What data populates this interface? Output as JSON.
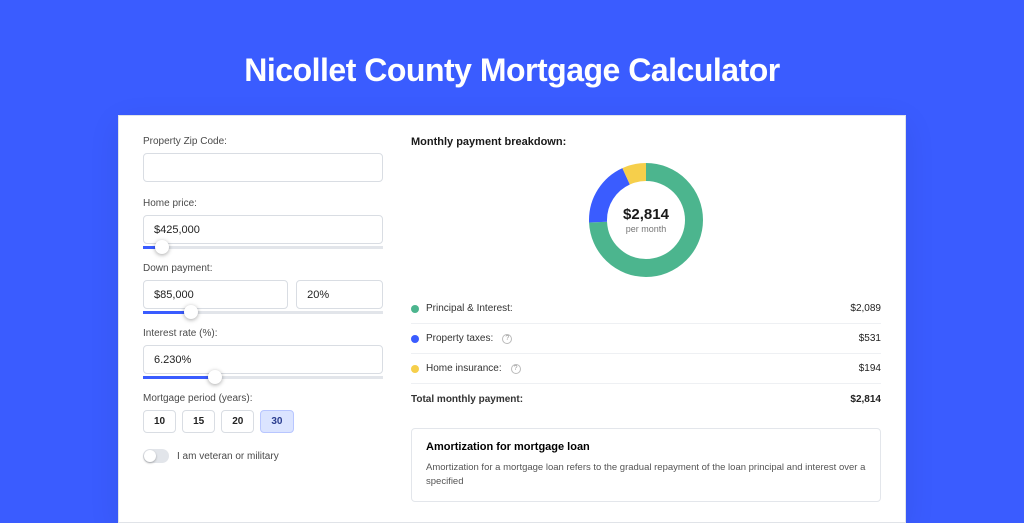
{
  "title": "Nicollet County Mortgage Calculator",
  "form": {
    "zip": {
      "label": "Property Zip Code:",
      "value": ""
    },
    "home_price": {
      "label": "Home price:",
      "value": "$425,000",
      "slider_pct": 8
    },
    "down_payment": {
      "label": "Down payment:",
      "amount": "$85,000",
      "pct": "20%",
      "slider_pct": 20
    },
    "interest_rate": {
      "label": "Interest rate (%):",
      "value": "6.230%",
      "slider_pct": 30
    },
    "period": {
      "label": "Mortgage period (years):",
      "options": [
        "10",
        "15",
        "20",
        "30"
      ],
      "selected": "30"
    },
    "veteran": {
      "label": "I am veteran or military",
      "on": false
    }
  },
  "breakdown": {
    "title": "Monthly payment breakdown:",
    "center_amount": "$2,814",
    "center_sub": "per month",
    "items": [
      {
        "dot": "#4cb58e",
        "label": "Principal & Interest:",
        "value": "$2,089",
        "info": false
      },
      {
        "dot": "#3a5cff",
        "label": "Property taxes:",
        "value": "$531",
        "info": true
      },
      {
        "dot": "#f6cf4b",
        "label": "Home insurance:",
        "value": "$194",
        "info": true
      }
    ],
    "total_label": "Total monthly payment:",
    "total_value": "$2,814"
  },
  "chart_data": {
    "type": "pie",
    "title": "Monthly payment breakdown",
    "series": [
      {
        "name": "Principal & Interest",
        "value": 2089,
        "color": "#4cb58e"
      },
      {
        "name": "Property taxes",
        "value": 531,
        "color": "#3a5cff"
      },
      {
        "name": "Home insurance",
        "value": 194,
        "color": "#f6cf4b"
      }
    ],
    "total": 2814
  },
  "amortization": {
    "title": "Amortization for mortgage loan",
    "text": "Amortization for a mortgage loan refers to the gradual repayment of the loan principal and interest over a specified"
  }
}
